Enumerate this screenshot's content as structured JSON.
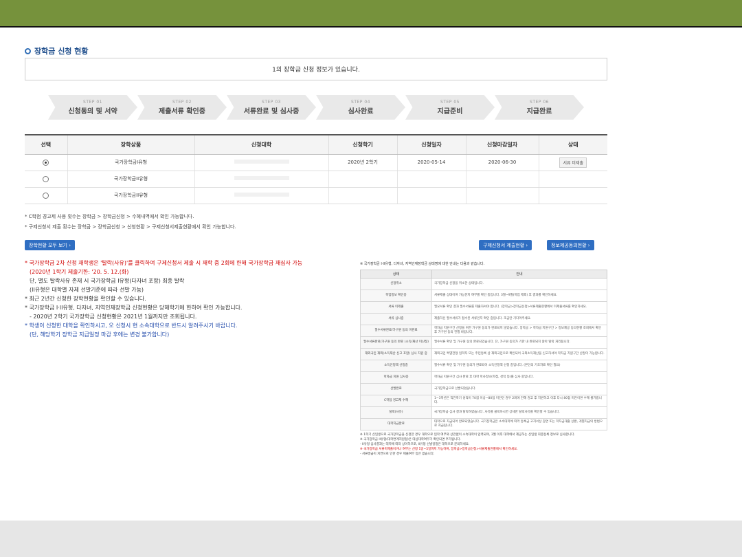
{
  "section_title": "장학금 신청 현황",
  "info_message": "1의 장학금 신청 정보가 있습니다.",
  "steps": [
    {
      "num": "STEP 01",
      "label": "신청동의 및 서약"
    },
    {
      "num": "STEP 02",
      "label": "제출서류 확인중"
    },
    {
      "num": "STEP 03",
      "label": "서류완료 및 심사중"
    },
    {
      "num": "STEP 04",
      "label": "심사완료"
    },
    {
      "num": "STEP 05",
      "label": "지급준비"
    },
    {
      "num": "STEP 06",
      "label": "지급완료"
    }
  ],
  "table": {
    "headers": [
      "선택",
      "장학상품",
      "신청대학",
      "신청학기",
      "신청일자",
      "신청마감일자",
      "상태"
    ],
    "rows": [
      {
        "product": "국가장학금I유형",
        "semester": "2020년 2학기",
        "date": "2020-05-14",
        "deadline": "2020-06-30",
        "status": "서류 미제출"
      },
      {
        "product": "국가장학금II유형"
      },
      {
        "product": "국가장학금II유형"
      }
    ]
  },
  "notes": [
    "* C학점 경고제 사용 횟수는 장학금 > 장학금신청 > 수혜내역에서 확인 가능합니다.",
    "* 구제신청서 제출 횟수는 장학금 > 장학금신청 > 신청현황 > 구제신청서제출현황에서 확인 가능합니다."
  ],
  "buttons": {
    "view_all": "장학현황 모두 보기",
    "appeal_status": "구제신청서 제출현황",
    "info_consent": "정보제공동의현황"
  },
  "left_notes": [
    "* 국가장학금 2차 신청 재학생은 '탈락(사유)'를 클릭하여 구제신청서 제출 시 재학 중 2회에 한해 국가장학금 재심사 가능",
    "(2020년 1학기 제출기한: '20. 5. 12.(화)",
    "단, 별도 탈락사유 존재 시 국가장학금 I유형(다자녀 포함) 최종 탈락",
    "(II유형은 대학별 자체 선발기준에 따라 선발 가능)",
    "* 최근 2년간 신청한 장학현황을 확인할 수 있습니다.",
    "* 국가장학금 I·II유형, 다자녀, 지역인재장학금 신청현황은 당해학기에 한하여 확인 가능합니다.",
    "- 2020년 2학기 국가장학금 신청현황은 2021년 1월까지만 조회됩니다.",
    "* 학생이 신청한 대학을 확인하시고, 오 신청시 현 소속대학으로 반드시 알려주시기 바랍니다.",
    "(단, 해당학기 장학금 지급일정 마감 후에는 변경 불가합니다)"
  ],
  "guide": {
    "intro": "※ 국가장학금 I·II유형, 다자녀, 지역인재장학금 상태명에 대한 안내는 다음과 같습니다.",
    "headers": [
      "상태",
      "안내"
    ],
    "rows": [
      {
        "status": "신청취소",
        "desc": "국가장학금 신청을 취소한 상태입니다."
      },
      {
        "status": "학업정보 확인중",
        "desc": "서류제출 상태이며 가능한지 여부를 확인 중입니다. 3월~9월(학업 제외) 후 결과를 확인하세요."
      },
      {
        "status": "서류 미제출",
        "desc": "필요서류 확인 결과 필수서류를 제출하셔야 합니다. (장학금>장학금신청>서류제출현황에서 미제출서류를 확인하세요."
      },
      {
        "status": "서류 심사중",
        "desc": "제출하신 필수서류가 접수된 서류인지 확인 중입니다. 조금만 기다려주세요."
      },
      {
        "status": "필수서류완료/가구원 동의 미완료",
        "desc": "학자금 지원구간 산정을 위한 가구원 동의가 완료되지 않았습니다. 장학금 > 학자금 지원구간 > 정보제공 동의현황 조회에서 확인 후 가구원 동의 진행 바랍니다."
      },
      {
        "status": "필수서류완료/가구원 동의 완료 (소득/재산 미산정)",
        "desc": "필수서류 확인 및 가구원 동의 완료되었습니다. 단, 가구원 동의가 기한 내 완료되지 않아 탈락 처리됩니다."
      },
      {
        "status": "재외국민 재외(소득재산 신고 포함) 심사 지원 중",
        "desc": "재외국민 특별전형 입학자 또는 주민등록 상 재외국민으로 확인되어 국외소득재산을 신고하셔야 학자금 지원구간 산정이 가능합니다."
      },
      {
        "status": "소득인정액 산정중",
        "desc": "필수서류 확인 및 가구원 동의가 완료되어 소득인정액 산정 중입니다. (본인의 기초자료 확인 필요)"
      },
      {
        "status": "학자금 지원 심사중",
        "desc": "학자금 지원구간 심사 완료 후 대학 학사정보(학점, 성적 등)를 심사 중입니다."
      },
      {
        "status": "선발완료",
        "desc": "국가장학금으로 선발되었습니다."
      },
      {
        "status": "C학점 경고제 수혜",
        "desc": "1~3학년은 직전학기 성적이 70점 이상~80점 미만인 경우 2회에 한해 경고 후 지원하고 이후 다시 80점 미만이면 수혜 불가합니다."
      },
      {
        "status": "탈락(사유)",
        "desc": "국가장학금 심사 결과 탈락하였습니다. 사유를 클릭하시면 상세한 탈락사유를 확인할 수 있습니다."
      },
      {
        "status": "대학지급완료",
        "desc": "대학으로 지급되어 완료되었습니다. 국가장학금은 소속대학에 따라 등록금 고지서상 감면 또는 학자금대출 상환, 개별지급의 방법으로 지급됩니다."
      }
    ],
    "footnotes": [
      "※ 1학기 신입생으로 국가장학금을 신청한 경우 대학으로 입학 여부와 상관없이 소속대학이 입력되며, 3월 이후 대학에서 제공하는 신입생 최종등록 정보로 심사합니다.",
      "※ 국가장학금 II유형(대학연계지원형)은 대상대학여부가 확인되면 추가됩니다.",
      "- II유형 심사결과는 대학에 따라 상이하므로, II유형 선발일정은 대학으로 문의하세요.",
      "※ 국가장학금 서류미제출이거나 여부는 신청 1일~5일까지 가능하며, 장학금>장학금신청>서류제출현황에서 확인하세요.",
      "- 서류발급이 지연으로 인한 경우 제출여부 등은 없습니다."
    ]
  }
}
